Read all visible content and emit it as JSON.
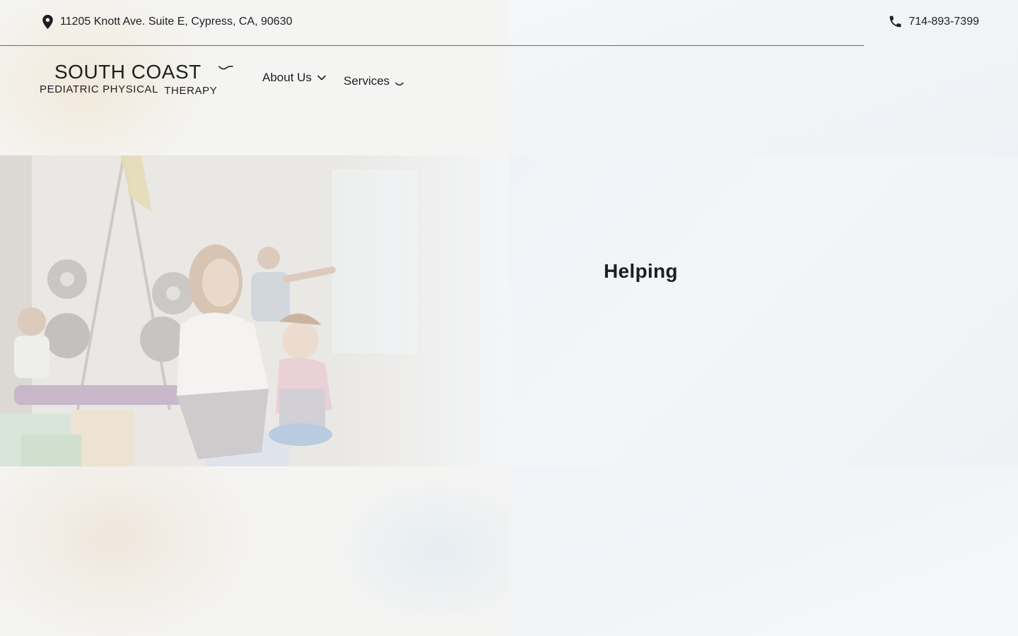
{
  "topbar": {
    "address": "11205 Knott Ave. Suite E, Cypress, CA, 90630",
    "phone": "714-893-7399"
  },
  "logo": {
    "line1": "SOUTH COAST",
    "line2": "PEDIATRIC PHYSICAL",
    "line3": "THERAPY"
  },
  "nav": {
    "items": [
      {
        "label": "About Us",
        "has_dropdown": true
      },
      {
        "label": "Services",
        "has_dropdown": true
      }
    ]
  },
  "hero": {
    "heading": "Helping"
  },
  "icons": {
    "address": "location-pin-icon",
    "phone": "phone-icon",
    "logo_mark": "bird-icon",
    "dropdown": "chevron-down-icon"
  },
  "colors": {
    "text": "#1d1f22",
    "background": "#f5f6f8",
    "divider": "#6b6b6b"
  }
}
